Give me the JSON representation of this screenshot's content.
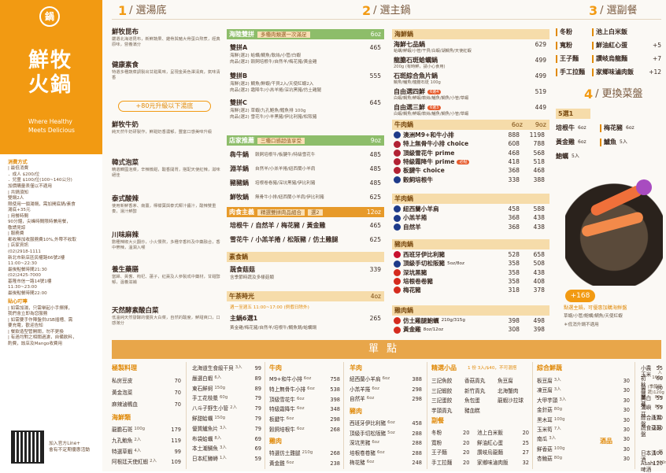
{
  "brand": {
    "logo": "鍋",
    "name_line1": "鮮牧",
    "name_line2": "火鍋",
    "en1": "Where Healthy",
    "en2": "Meets Delicious"
  },
  "info": [
    {
      "h": "消費方式",
      "t": ""
    },
    {
      "h": "",
      "t": "| 最低消費"
    },
    {
      "h": "",
      "t": "．成人 $200/位"
    },
    {
      "h": "",
      "t": "．兒童 $100/位(100~140公分)"
    },
    {
      "h": "",
      "t": "加價購量表僅以不適用"
    },
    {
      "h": "",
      "t": "| 共鍋須知"
    },
    {
      "h": "",
      "t": "雙鍋2人"
    },
    {
      "h": "",
      "t": "限使用一個湯鍋，需加開底鍋/素食"
    },
    {
      "h": "",
      "t": "湯底+35元"
    },
    {
      "h": "",
      "t": "| 用餐時間"
    },
    {
      "h": "",
      "t": "90分鐘，尖峰時間限時兼用餐，"
    },
    {
      "h": "",
      "t": "敬請見諒"
    },
    {
      "h": "",
      "t": "| 服務費"
    },
    {
      "h": "",
      "t": "都收無加收服務費10%,外帶不收取"
    },
    {
      "h": "",
      "t": "| 店家資訊"
    },
    {
      "h": "",
      "t": "(02)2918-1111"
    },
    {
      "h": "",
      "t": "新北市新店區民權路66號2樓"
    },
    {
      "h": "",
      "t": "11:00~22:30"
    },
    {
      "h": "",
      "t": "最後點餐時間21:30"
    },
    {
      "h": "",
      "t": "(02)2425-7000"
    },
    {
      "h": "",
      "t": "基隆市信一路14號1樓"
    },
    {
      "h": "",
      "t": "11:30~23:00"
    },
    {
      "h": "",
      "t": "最後點餐時間22:00"
    },
    {
      "h": "貼心叮嚀",
      "t": ""
    },
    {
      "h": "",
      "t": "| 如需加湯，只需舉起小手揮揮，"
    },
    {
      "h": "",
      "t": "我們會立即為您服務"
    },
    {
      "h": "",
      "t": "| 如需要手作陣盤供USB插槽、需"
    },
    {
      "h": "",
      "t": "要充電，歡迎告知"
    },
    {
      "h": "",
      "t": "| 餐飲造型管開關，勿不更換"
    },
    {
      "h": "",
      "t": "| 有過均對之相關過濾，自備飲料，"
    },
    {
      "h": "",
      "t": "酌費，該店及Mango收費用"
    }
  ],
  "qr": {
    "label1": "加入官方Line+",
    "label2": "會有不定期優惠活動"
  },
  "col1": {
    "num": "1",
    "title": "選湯底"
  },
  "col2": {
    "num": "2",
    "title": "選主鍋"
  },
  "col3": {
    "num": "3",
    "title": "選副餐"
  },
  "col4": {
    "num": "4",
    "title": "更換菜盤"
  },
  "soups": [
    {
      "name": "鮮牧昆布",
      "desc": "嚴選北海道昆布，新鮮蔬果、雞骨與豬大骨蛋白熬煮，經典原味，營養滿分"
    },
    {
      "name": "健康素食",
      "desc": "特選多種蔬菜調製出甘甜風味，呈現金黃色澤清爽，氣味清香"
    },
    {
      "name": "鮮牧牛奶",
      "desc": "純天然牛奶研製作，鮮甜奶香濃郁，豐富口感美味升級"
    },
    {
      "name": "韓式泡菜",
      "tag": "天使紅辣1入",
      "desc": "精選韓國泡菜，辛辣微甜，酸香開胃，搭配天使紅辣，滋味絕佳"
    },
    {
      "name": "泰式酸辣",
      "tag": "天使紅辣2入",
      "desc": "使用新鮮香茅、南薑，檸檬葉與泰式椰汁醬汁，酸辣雙重奏，湯汁鮮醇"
    },
    {
      "name": "川味麻辣",
      "desc": "數種辣椒大火翻炒，小火慢熬，多種辛香料及中藥融合，香中帶辣，溫潤入喉"
    },
    {
      "name": "養生藥膳",
      "desc": "當歸、黃耆、枸杞、蓮子，紅棗及人參製成中藥材，甘甜醇郁，溫養滋補"
    },
    {
      "name": "天然酵素酸白菜",
      "desc": "低溫純天然發酵的優質大白菜，自然的酸度，鮮甜爽口，口感滿分"
    }
  ],
  "upgrade": "+80元升級以下湯底",
  "mid": {
    "sec1": {
      "title": "海陸雙拼",
      "sub": "多種肉類選一次滿足",
      "price": "6oz"
    },
    "sec1_items": [
      {
        "name": "雙拼A",
        "line1": "海鮮(選2) 蛤蠣/鯛魚/軟絲/小管/白蝦",
        "line2": "肉品(選2) 穀飼培根牛/自然羊/梅花豬/黃金雞",
        "price": "465"
      },
      {
        "name": "雙拼B",
        "line1": "海鮮(選2) 鯛魚/鮮蝦/干貝2入/天使紅蝦2入",
        "line2": "肉品(選2) 霜降牛/小羔羊捲/深坑黑豬/仿土雞腿",
        "price": "555"
      },
      {
        "name": "雙拼C",
        "line1": "海鮮(選2) 草蝦/九孔鮑魚/鱈魚排 100g",
        "line2": "肉品(選2) 雪花牛/小羊黑豬/伊比利豬/松阪豬",
        "price": "645"
      }
    ],
    "sec2": {
      "title": "店家推薦",
      "sub": "三種口感超值享受",
      "price": "9oz"
    },
    "sec2_items": [
      {
        "name": "犇牛鍋",
        "desc": "穀飼培根牛/板腱牛/特級雪花牛",
        "price": "485"
      },
      {
        "name": "淵羊鍋",
        "desc": "自然羊/小羔羊捲/紐西蘭小羊肩",
        "price": "485"
      },
      {
        "name": "豬豬鍋",
        "desc": "培根卷卷豬/深坑黑豬/伊比利豬",
        "price": "485"
      },
      {
        "name": "鮮牧鍋",
        "desc": "無骨牛小排/紐西蘭小羊肩/伊比利豬",
        "price": "625"
      }
    ],
    "sec3": {
      "title": "肉食主義",
      "sub": "精選雙拼肉品組合",
      "badge": "選2",
      "price": "12oz"
    },
    "sec3_items": [
      {
        "name": "培根牛 / 自然羊 / 梅花豬 / 黃金雞",
        "price": "465"
      },
      {
        "name": "雪花牛 / 小羔羊捲 / 松阪豬 / 仿土雞腿",
        "price": "625"
      }
    ],
    "sec4": {
      "title": "素食鍋"
    },
    "sec4_items": [
      {
        "name": "蔬食菇菇",
        "desc": "含季節時蔬及多樣菇類",
        "price": "339"
      }
    ],
    "sec5": {
      "title": "午茶時光",
      "price": "4oz"
    },
    "sec5_note": "週一至週五 11:00~17:00 (例假日除外)",
    "sec5_items": [
      {
        "name": "主鍋6選1",
        "price": "265"
      }
    ],
    "sec5_desc": "黃金雞/梅花豬/自然羊/培根牛/鯛魚鍋/蛤蠣鍋"
  },
  "sea": {
    "title": "海鮮鍋",
    "items": [
      {
        "name": "海鮮七品鍋",
        "desc": "蛤蠣/鮮蝦/小管/干貝/白蝦/湖鯛魚/天使紅蝦",
        "price": "629"
      },
      {
        "name": "龍膽石斑蛤蠣鍋",
        "desc": "200g (有時鮮，請小心食用)",
        "price": "499"
      },
      {
        "name": "石斑綜合魚片鍋",
        "desc": "鯛魚/鱸魚/龍膽石斑 100g",
        "price": "499"
      },
      {
        "name": "自由選四鮮",
        "badge": "6選4",
        "desc": "白蝦/鯛魚/鮮蝦/軟絲/鱸魚/鯛魚/小管/草蝦",
        "price": "519"
      },
      {
        "name": "自由選三鮮",
        "badge": "6選3",
        "desc": "白蝦/鯛魚/鮮蝦/軟絲/鱸魚/鯛魚/小管/草蝦",
        "price": "449"
      }
    ]
  },
  "beef": {
    "title": "牛肉鍋",
    "c1": "6oz",
    "c2": "9oz",
    "items": [
      {
        "name": "澳洲M9+和牛小排",
        "p1": "888",
        "p2": "1198",
        "flag": "#1e3b8a"
      },
      {
        "name": "特上無骨牛小排 choice",
        "p1": "608",
        "p2": "788",
        "flag": "#b22234"
      },
      {
        "name": "頂級雪花牛 prime",
        "p1": "468",
        "p2": "568",
        "flag": "#b22234"
      },
      {
        "name": "特級霜降牛 prime",
        "p1": "418",
        "p2": "518",
        "flag": "#b22234",
        "hot": "必點"
      },
      {
        "name": "板腱牛 choice",
        "p1": "368",
        "p2": "468",
        "flag": "#b22234"
      },
      {
        "name": "穀飼培根牛",
        "p1": "338",
        "p2": "388",
        "flag": "#1e3b8a"
      }
    ]
  },
  "lamb": {
    "title": "羊肉鍋",
    "items": [
      {
        "name": "紐西蘭小羊肩",
        "p1": "458",
        "p2": "588",
        "flag": "#1e3b8a"
      },
      {
        "name": "小羔羊捲",
        "p1": "368",
        "p2": "438",
        "flag": "#1e3b8a"
      },
      {
        "name": "自然羊",
        "p1": "368",
        "p2": "438",
        "flag": "#1e3b8a"
      }
    ]
  },
  "pork": {
    "title": "豬肉鍋",
    "items": [
      {
        "name": "西班牙伊比利豬",
        "p1": "528",
        "p2": "658",
        "flag": "#c8102e"
      },
      {
        "name": "頂級手切松阪豬",
        "note": "5oz/8oz",
        "p1": "358",
        "p2": "508",
        "flag": "#1e3b8a"
      },
      {
        "name": "深坑黑豬",
        "p1": "358",
        "p2": "438",
        "flag": "#d52b1e"
      },
      {
        "name": "培根卷卷豬",
        "p1": "358",
        "p2": "408",
        "flag": "#d52b1e"
      },
      {
        "name": "梅花豬",
        "p1": "318",
        "p2": "378",
        "flag": "#d52b1e"
      }
    ]
  },
  "chicken": {
    "title": "雞肉鍋",
    "items": [
      {
        "name": "仿土雞腿鮑蠣",
        "note": "210g/315g",
        "p1": "398",
        "p2": "498",
        "flag": "#d52b1e"
      },
      {
        "name": "黃金雞",
        "note": "8oz/12oz",
        "p1": "308",
        "p2": "398",
        "flag": "#d52b1e"
      }
    ]
  },
  "sides": [
    {
      "a": "冬粉",
      "b": "池上白米飯"
    },
    {
      "a": "寬粉",
      "b": "鮮油紅心蛋",
      "bp": "+5"
    },
    {
      "a": "王子麵",
      "b": "讚岐烏龍麵",
      "bp": "+7"
    },
    {
      "a": "手工拉麵",
      "b": "家鄉味滷肉飯",
      "bp": "+12"
    }
  ],
  "swap": {
    "badge": "5選1",
    "items": [
      {
        "a": "培根牛",
        "ap": "6oz",
        "b": "梅花豬",
        "bp": "6oz"
      },
      {
        "a": "黃金雞",
        "ap": "6oz",
        "b": "鱸魚",
        "bp": "5入"
      },
      {
        "a": "鮑蠣",
        "ap": "5入"
      }
    ]
  },
  "promo": {
    "price": "+168",
    "line1": "點選主鍋，可優惠加購海鮮盤",
    "line2": "草蝦/小管/鮑蠣/鯛魚/天使紅蝦",
    "line3": "＊低消升鍋不適用"
  },
  "ala": {
    "title": "單點",
    "c1": {
      "title": "極製料理",
      "items": [
        {
          "n": "私房豆皮",
          "p": "70"
        },
        {
          "n": "黃金泡菜",
          "p": "70"
        },
        {
          "n": "麻辣滷鴨血",
          "p": "70"
        }
      ]
    },
    "c1b": {
      "title": "海鮮類",
      "items": [
        {
          "n": "龍膽石斑",
          "q": "100g",
          "p": "179"
        },
        {
          "n": "九孔鮑魚",
          "q": "2入",
          "p": "119"
        },
        {
          "n": "特選草蝦",
          "q": "4入",
          "p": "99"
        },
        {
          "n": "阿根廷天使紅蝦",
          "q": "2入",
          "p": "109"
        }
      ]
    },
    "c2": {
      "items": [
        {
          "n": "北海道生食級干貝",
          "q": "3入",
          "p": "99"
        },
        {
          "n": "嚴選白蝦",
          "q": "6入",
          "p": "89"
        },
        {
          "n": "東石鮮蚵",
          "q": "150g",
          "p": "89"
        },
        {
          "n": "手工花枝漿",
          "q": "60g",
          "p": "79"
        },
        {
          "n": "八斗子野生小管",
          "q": "2入",
          "p": "79"
        },
        {
          "n": "鮮甜蛤蠣",
          "q": "150g",
          "p": "79"
        },
        {
          "n": "優質鱸魚片",
          "q": "3入",
          "p": "79"
        },
        {
          "n": "布袋蛤蠣",
          "q": "8入",
          "p": "69"
        },
        {
          "n": "本土潮鯛魚",
          "q": "3入",
          "p": "69"
        },
        {
          "n": "日本紅鱒蟳",
          "q": "1入",
          "p": "59"
        }
      ]
    },
    "c3": {
      "title": "牛肉",
      "items": [
        {
          "n": "M9+和牛小排",
          "q": "6oz",
          "p": "758"
        },
        {
          "n": "特上無骨牛小排",
          "q": "6oz",
          "p": "538"
        },
        {
          "n": "頂級雪花牛",
          "q": "6oz",
          "p": "398"
        },
        {
          "n": "特級霜降牛",
          "q": "6oz",
          "p": "348"
        },
        {
          "n": "板腱牛",
          "q": "6oz",
          "p": "298"
        },
        {
          "n": "穀飼培根牛",
          "q": "6oz",
          "p": "268"
        }
      ]
    },
    "c3b": {
      "title": "雞肉",
      "items": [
        {
          "n": "特選仿土雞腿",
          "q": "210g",
          "p": "268"
        },
        {
          "n": "黃金雞",
          "q": "6oz",
          "p": "238"
        }
      ]
    },
    "c4": {
      "title": "羊肉",
      "items": [
        {
          "n": "紐西蘭小羊肩",
          "q": "6oz",
          "p": "388"
        },
        {
          "n": "小羔羊捲",
          "q": "6oz",
          "p": "298"
        },
        {
          "n": "自然羊",
          "q": "6oz",
          "p": "298"
        }
      ]
    },
    "c4b": {
      "title": "豬肉",
      "items": [
        {
          "n": "西班牙伊比利豬",
          "q": "6oz",
          "p": "458"
        },
        {
          "n": "頂級手切松阪豬",
          "q": "5oz",
          "p": "288"
        },
        {
          "n": "深坑黑豬",
          "q": "6oz",
          "p": "288"
        },
        {
          "n": "培根卷卷豬",
          "q": "6oz",
          "p": "288"
        },
        {
          "n": "梅花豬",
          "q": "6oz",
          "p": "248"
        }
      ]
    },
    "c5": {
      "title": "精選小品",
      "note": "1 份 3入/$40，不可混搭",
      "items": [
        [
          "三記魚餃",
          "香菇貢丸",
          "魚豆腐"
        ],
        [
          "三記蝦餃",
          "新竹貢丸",
          "北海蟹肉"
        ],
        [
          "三記蛋餃",
          "魚包蛋",
          "龍蝦沙拉球"
        ],
        [
          "芋頭貢丸",
          "豬血糕",
          ""
        ]
      ]
    },
    "c5b": {
      "title": "副餐",
      "items": [
        {
          "a": "冬粉",
          "ap": "20",
          "b": "池上白米飯",
          "bp": "20"
        },
        {
          "a": "寬粉",
          "ap": "20",
          "b": "鮮油紅心蛋",
          "bp": "25"
        },
        {
          "a": "王子麵",
          "ap": "20",
          "b": "讚岐烏龍麵",
          "bp": "27"
        },
        {
          "a": "手工拉麵",
          "ap": "20",
          "b": "家鄉味滷肉飯",
          "bp": "32"
        }
      ]
    },
    "c6": {
      "title": "綜合鮮蔬",
      "items": [
        {
          "n": "板豆腐",
          "q": "3入",
          "p": "30"
        },
        {
          "n": "凍豆腐",
          "q": "3入",
          "p": "30"
        },
        {
          "n": "大甲芋頭",
          "q": "3入",
          "p": "30"
        },
        {
          "n": "金針菇",
          "q": "80g",
          "p": "30"
        },
        {
          "n": "黑木耳",
          "q": "100g",
          "p": "30"
        },
        {
          "n": "玉米筍",
          "q": "7入",
          "p": "30"
        },
        {
          "n": "南瓜",
          "q": "3入",
          "p": "30"
        },
        {
          "n": "鮮香菇",
          "q": "100g",
          "p": "30"
        },
        {
          "n": "杏鮑菇",
          "q": "80g",
          "p": "30"
        }
      ]
    },
    "c7": {
      "items": [
        {
          "n": "小農玉米",
          "q": "5入",
          "p": "55"
        },
        {
          "n": "初秋高麗菜",
          "q": "160g",
          "p": "60"
        },
        {
          "n": "茼蒿",
          "q": "(季節時蔬)120g",
          "p": "60"
        },
        {
          "n": "美白菇",
          "q": "80g",
          "p": "55"
        },
        {
          "n": "滿嶼菇",
          "q": "80g",
          "p": "55"
        },
        {
          "n": "綜合蔬菜盤",
          "p": "170"
        },
        {
          "n": "蔬食菇菇盤",
          "p": "230"
        }
      ]
    },
    "c7b": {
      "title": "酒品",
      "items": [
        {
          "n": "日本清酒",
          "q": "瓶",
          "p": "100"
        },
        {
          "n": "Asahi啤酒",
          "q": "600ml",
          "p": "120"
        }
      ]
    }
  }
}
